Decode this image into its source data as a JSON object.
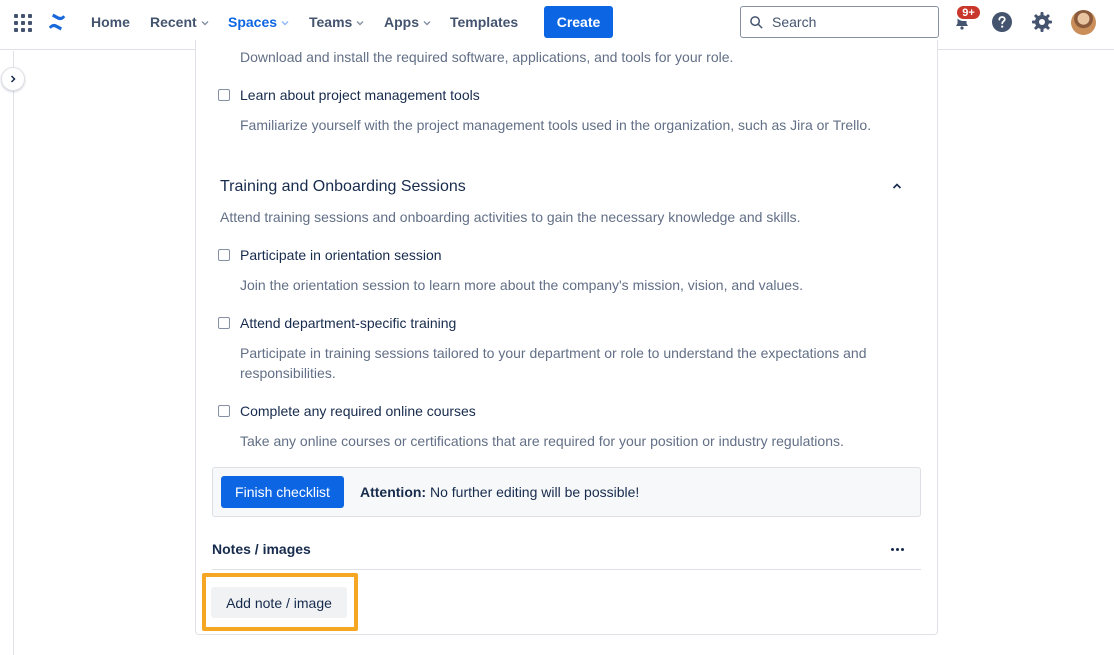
{
  "nav": {
    "items": [
      {
        "label": "Home",
        "has_chevron": false
      },
      {
        "label": "Recent",
        "has_chevron": true
      },
      {
        "label": "Spaces",
        "has_chevron": true,
        "active": true
      },
      {
        "label": "Teams",
        "has_chevron": true
      },
      {
        "label": "Apps",
        "has_chevron": true
      },
      {
        "label": "Templates",
        "has_chevron": false
      }
    ],
    "create_label": "Create",
    "search_placeholder": "Search",
    "notifications_badge": "9+",
    "icons": [
      "app-switcher-icon",
      "confluence-logo-icon",
      "search-icon",
      "notification-bell-icon",
      "help-icon",
      "settings-gear-icon",
      "avatar"
    ]
  },
  "checklist": {
    "partial_item_desc": "Download and install the required software, applications, and tools for your role.",
    "item_pm": {
      "label": "Learn about project management tools",
      "desc": "Familiarize yourself with the project management tools used in the organization, such as Jira or Trello."
    },
    "section": {
      "title": "Training and Onboarding Sessions",
      "desc": "Attend training sessions and onboarding activities to gain the necessary knowledge and skills.",
      "items": [
        {
          "label": "Participate in orientation session",
          "desc": "Join the orientation session to learn more about the company's mission, vision, and values."
        },
        {
          "label": "Attend department-specific training",
          "desc": "Participate in training sessions tailored to your department or role to understand the expectations and responsibilities."
        },
        {
          "label": "Complete any required online courses",
          "desc": "Take any online courses or certifications that are required for your position or industry regulations."
        }
      ]
    },
    "finish": {
      "button_label": "Finish checklist",
      "attention_label": "Attention:",
      "attention_text": " No further editing will be possible!"
    }
  },
  "notes": {
    "title": "Notes / images",
    "add_button_label": "Add note / image"
  },
  "colors": {
    "primary": "#0c66e4",
    "highlight": "#f5a623",
    "badge": "#c9372c",
    "text": "#172b4d",
    "subtle_text": "#626f86"
  }
}
